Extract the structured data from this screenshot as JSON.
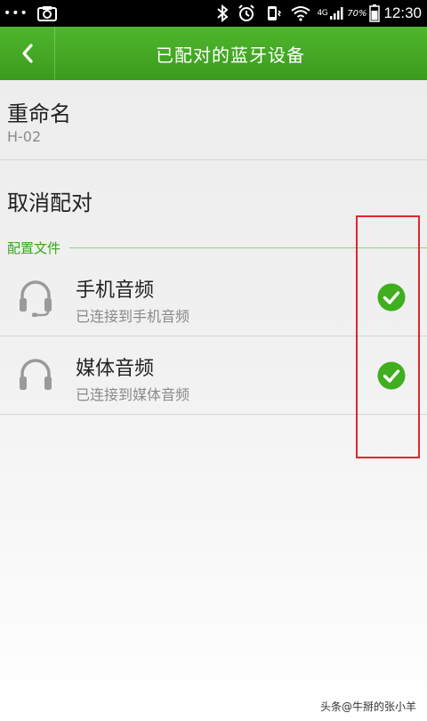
{
  "status_bar": {
    "dots": "•••",
    "network": "4G",
    "battery_percent": "70%",
    "time": "12:30"
  },
  "header": {
    "title": "已配对的蓝牙设备"
  },
  "rename": {
    "title": "重命名",
    "device_name": "H-02"
  },
  "unpair": {
    "label": "取消配对"
  },
  "profiles": {
    "section_label": "配置文件",
    "items": [
      {
        "name": "手机音频",
        "status": "已连接到手机音频",
        "icon": "headset-mic-icon",
        "checked": true
      },
      {
        "name": "媒体音频",
        "status": "已连接到媒体音频",
        "icon": "headphones-icon",
        "checked": true
      }
    ]
  },
  "watermark": "头条@牛掰的张小羊",
  "colors": {
    "accent": "#4fb52c",
    "check": "#3fae1f",
    "highlight": "#e0262c"
  }
}
